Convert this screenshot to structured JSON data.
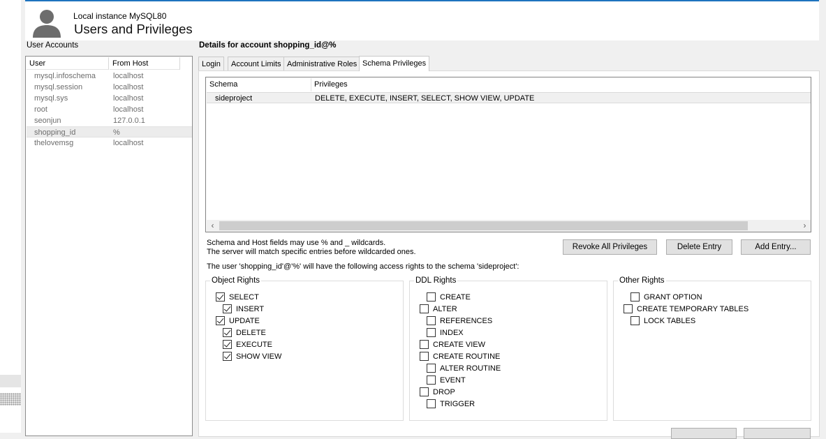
{
  "header": {
    "instance": "Local instance MySQL80",
    "title": "Users and Privileges"
  },
  "user_accounts": {
    "label": "User Accounts",
    "columns": [
      "User",
      "From Host"
    ],
    "rows": [
      {
        "user": "mysql.infoschema",
        "host": "localhost"
      },
      {
        "user": "mysql.session",
        "host": "localhost"
      },
      {
        "user": "mysql.sys",
        "host": "localhost"
      },
      {
        "user": "root",
        "host": "localhost"
      },
      {
        "user": "seonjun",
        "host": "127.0.0.1"
      },
      {
        "user": "shopping_id",
        "host": "%"
      },
      {
        "user": "thelovemsg",
        "host": "localhost"
      }
    ]
  },
  "details": {
    "title": "Details for account shopping_id@%",
    "tabs": [
      "Login",
      "Account Limits",
      "Administrative Roles",
      "Schema Privileges"
    ],
    "active_tab": "Schema Privileges"
  },
  "schema_table": {
    "columns": [
      "Schema",
      "Privileges"
    ],
    "rows": [
      {
        "schema": "sideproject",
        "privileges": "DELETE, EXECUTE, INSERT, SELECT, SHOW VIEW, UPDATE"
      }
    ]
  },
  "notes": {
    "wildcard_line1": "Schema and Host fields may use % and _ wildcards.",
    "wildcard_line2": "The server will match specific entries before wildcarded ones.",
    "access_rights": "The user 'shopping_id'@'%' will have the following access rights to the schema 'sideproject':"
  },
  "buttons": {
    "revoke_all": "Revoke All Privileges",
    "delete_entry": "Delete Entry",
    "add_entry": "Add Entry..."
  },
  "object_rights": {
    "title": "Object Rights",
    "items": [
      {
        "label": "SELECT",
        "checked": true
      },
      {
        "label": "INSERT",
        "checked": true
      },
      {
        "label": "UPDATE",
        "checked": true
      },
      {
        "label": "DELETE",
        "checked": true
      },
      {
        "label": "EXECUTE",
        "checked": true
      },
      {
        "label": "SHOW VIEW",
        "checked": true
      }
    ]
  },
  "ddl_rights": {
    "title": "DDL Rights",
    "items": [
      {
        "label": "CREATE",
        "checked": false
      },
      {
        "label": "ALTER",
        "checked": false
      },
      {
        "label": "REFERENCES",
        "checked": false
      },
      {
        "label": "INDEX",
        "checked": false
      },
      {
        "label": "CREATE VIEW",
        "checked": false
      },
      {
        "label": "CREATE ROUTINE",
        "checked": false
      },
      {
        "label": "ALTER ROUTINE",
        "checked": false
      },
      {
        "label": "EVENT",
        "checked": false
      },
      {
        "label": "DROP",
        "checked": false
      },
      {
        "label": "TRIGGER",
        "checked": false
      }
    ]
  },
  "other_rights": {
    "title": "Other Rights",
    "items": [
      {
        "label": "GRANT OPTION",
        "checked": false
      },
      {
        "label": "CREATE TEMPORARY TABLES",
        "checked": false
      },
      {
        "label": "LOCK TABLES",
        "checked": false
      }
    ]
  }
}
